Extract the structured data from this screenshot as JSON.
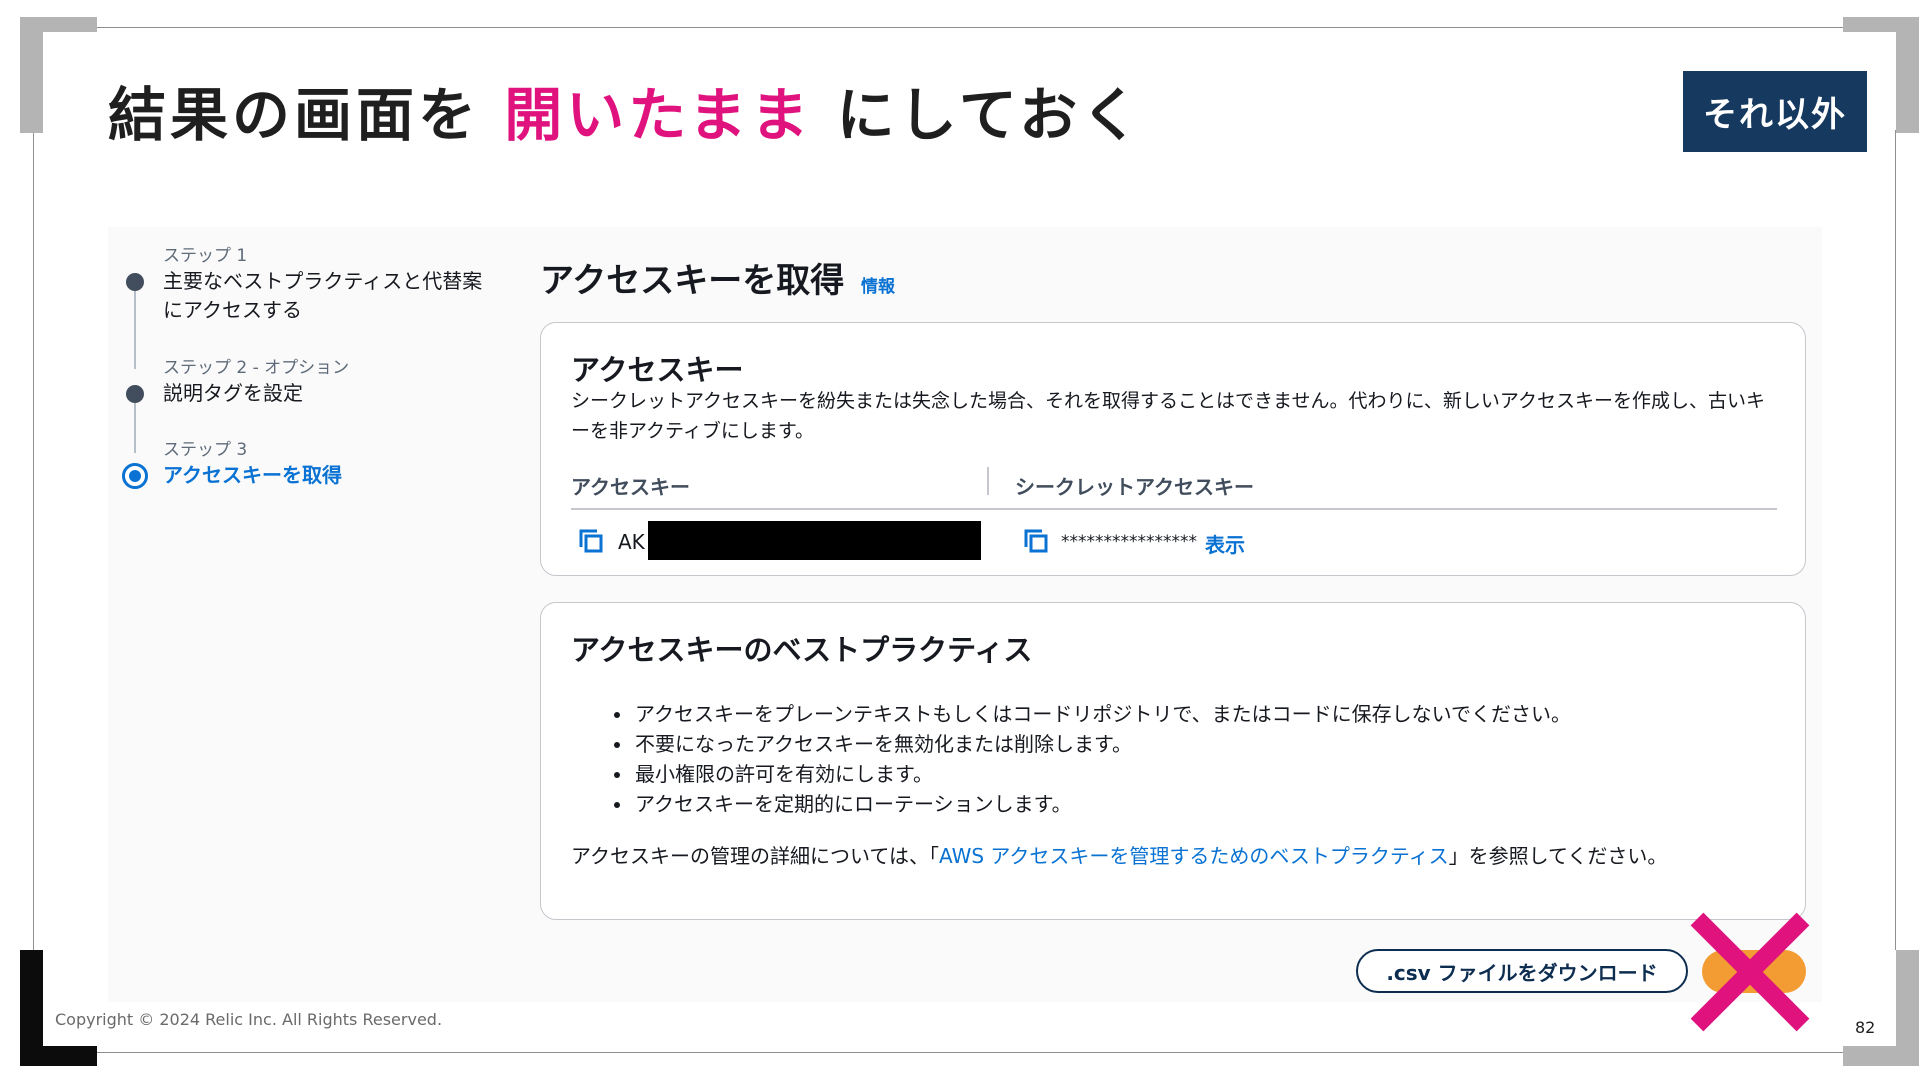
{
  "slide": {
    "title_part1": "結果の画面を ",
    "title_highlight": "開いたまま",
    "title_part2": " にしておく",
    "badge": "それ以外",
    "copyright": "Copyright © 2024 Relic Inc. All Rights Reserved.",
    "page_number": "82",
    "colors": {
      "highlight": "#e0127e",
      "badge_bg": "#163a5f",
      "link": "#0972d3",
      "primary_button": "#f39c33",
      "x_mark": "#e0127e"
    }
  },
  "wizard": {
    "steps": [
      {
        "sub": "ステップ 1",
        "name_line1": "主要なベストプラクティスと代替案",
        "name_line2": "にアクセスする",
        "state": "completed"
      },
      {
        "sub": "ステップ 2 - オプション",
        "name_line1": "説明タグを設定",
        "name_line2": "",
        "state": "completed"
      },
      {
        "sub": "ステップ 3",
        "name_line1": "アクセスキーを取得",
        "name_line2": "",
        "state": "active"
      }
    ]
  },
  "main": {
    "heading": "アクセスキーを取得",
    "info_link": "情報",
    "access_key_card": {
      "title": "アクセスキー",
      "description": "シークレットアクセスキーを紛失または失念した場合、それを取得することはできません。代わりに、新しいアクセスキーを作成し、古いキーを非アクティブにします。",
      "col_access_key": "アクセスキー",
      "col_secret_key": "シークレットアクセスキー",
      "access_key_value": "AK",
      "secret_key_masked": "****************",
      "show_link": "表示"
    },
    "best_practices_card": {
      "title": "アクセスキーのベストプラクティス",
      "bullets": [
        "アクセスキーをプレーンテキストもしくはコードリポジトリで、またはコードに保存しないでください。",
        "不要になったアクセスキーを無効化または削除します。",
        "最小権限の許可を有効にします。",
        "アクセスキーを定期的にローテーションします。"
      ],
      "ref_prefix": "アクセスキーの管理の詳細については、「",
      "ref_link": "AWS アクセスキーを管理するためのベストプラクティス",
      "ref_suffix": "」を参照してください。"
    },
    "csv_button": ".csv ファイルをダウンロード"
  }
}
